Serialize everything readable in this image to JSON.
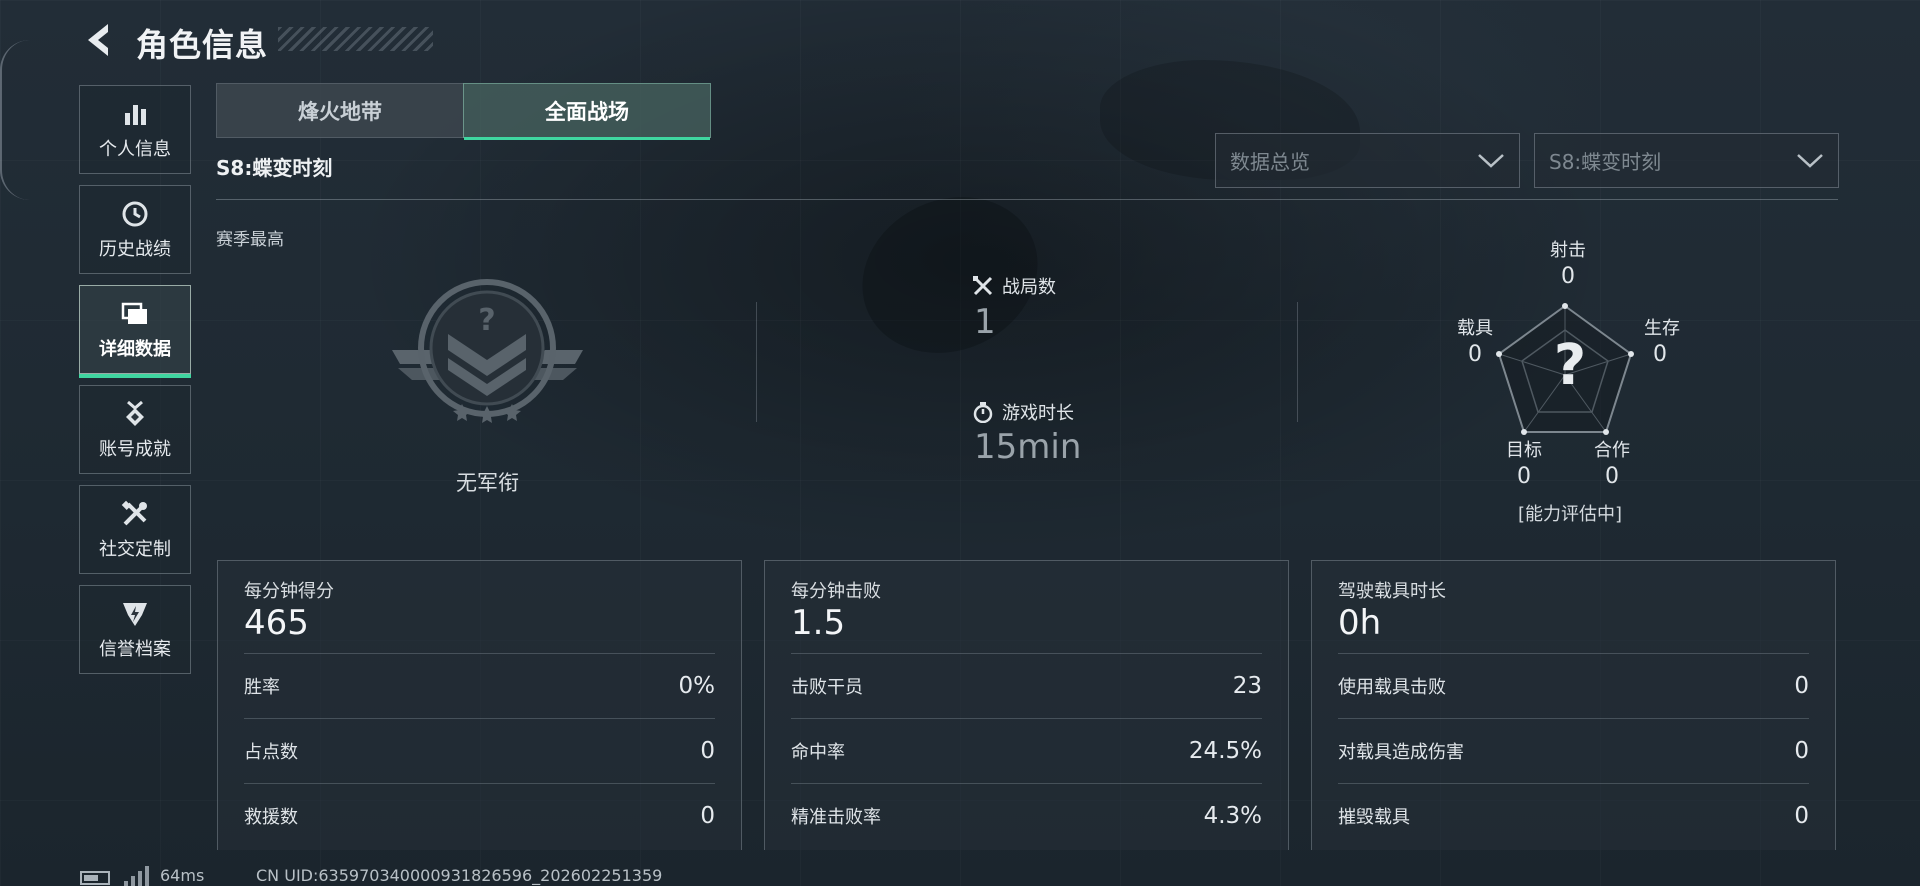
{
  "header": {
    "title": "角色信息",
    "back_icon": "back-arrow-icon"
  },
  "sidebar": {
    "items": [
      {
        "label": "个人信息",
        "icon": "bar-chart-icon",
        "active": false
      },
      {
        "label": "历史战绩",
        "icon": "history-clock-icon",
        "active": false
      },
      {
        "label": "详细数据",
        "icon": "folder-icon",
        "active": true
      },
      {
        "label": "账号成就",
        "icon": "medal-icon",
        "active": false
      },
      {
        "label": "社交定制",
        "icon": "tools-icon",
        "active": false
      },
      {
        "label": "信誉档案",
        "icon": "shield-badge-icon",
        "active": false
      }
    ],
    "accent_color": "#3fd6a0"
  },
  "tabs": [
    {
      "label": "烽火地带",
      "active": false
    },
    {
      "label": "全面战场",
      "active": true
    }
  ],
  "season": {
    "title": "S8:蝶变时刻"
  },
  "filters": {
    "category": {
      "value": "数据总览"
    },
    "season": {
      "value": "S8:蝶变时刻"
    }
  },
  "overview": {
    "best_label": "赛季最高",
    "rank_name": "无军衔",
    "matches": {
      "label": "战局数",
      "value": "1",
      "icon": "crossed-swords-icon"
    },
    "playtime": {
      "label": "游戏时长",
      "value": "15min",
      "icon": "stopwatch-icon"
    }
  },
  "radar": {
    "axes": [
      {
        "name": "射击",
        "value": "0"
      },
      {
        "name": "生存",
        "value": "0"
      },
      {
        "name": "合作",
        "value": "0"
      },
      {
        "name": "目标",
        "value": "0"
      },
      {
        "name": "载具",
        "value": "0"
      }
    ],
    "center_symbol": "?",
    "status": "[能力评估中]"
  },
  "cards": [
    {
      "head_label": "每分钟得分",
      "head_value": "465",
      "rows": [
        {
          "label": "胜率",
          "value": "0%"
        },
        {
          "label": "占点数",
          "value": "0"
        },
        {
          "label": "救援数",
          "value": "0"
        }
      ]
    },
    {
      "head_label": "每分钟击败",
      "head_value": "1.5",
      "rows": [
        {
          "label": "击败干员",
          "value": "23"
        },
        {
          "label": "命中率",
          "value": "24.5%"
        },
        {
          "label": "精准击败率",
          "value": "4.3%"
        }
      ]
    },
    {
      "head_label": "驾驶载具时长",
      "head_value": "0h",
      "rows": [
        {
          "label": "使用载具击败",
          "value": "0"
        },
        {
          "label": "对载具造成伤害",
          "value": "0"
        },
        {
          "label": "摧毁载具",
          "value": "0"
        }
      ]
    }
  ],
  "footer": {
    "ping": "64ms",
    "uid": "CN UID:635970340000931826596_202602251359"
  }
}
